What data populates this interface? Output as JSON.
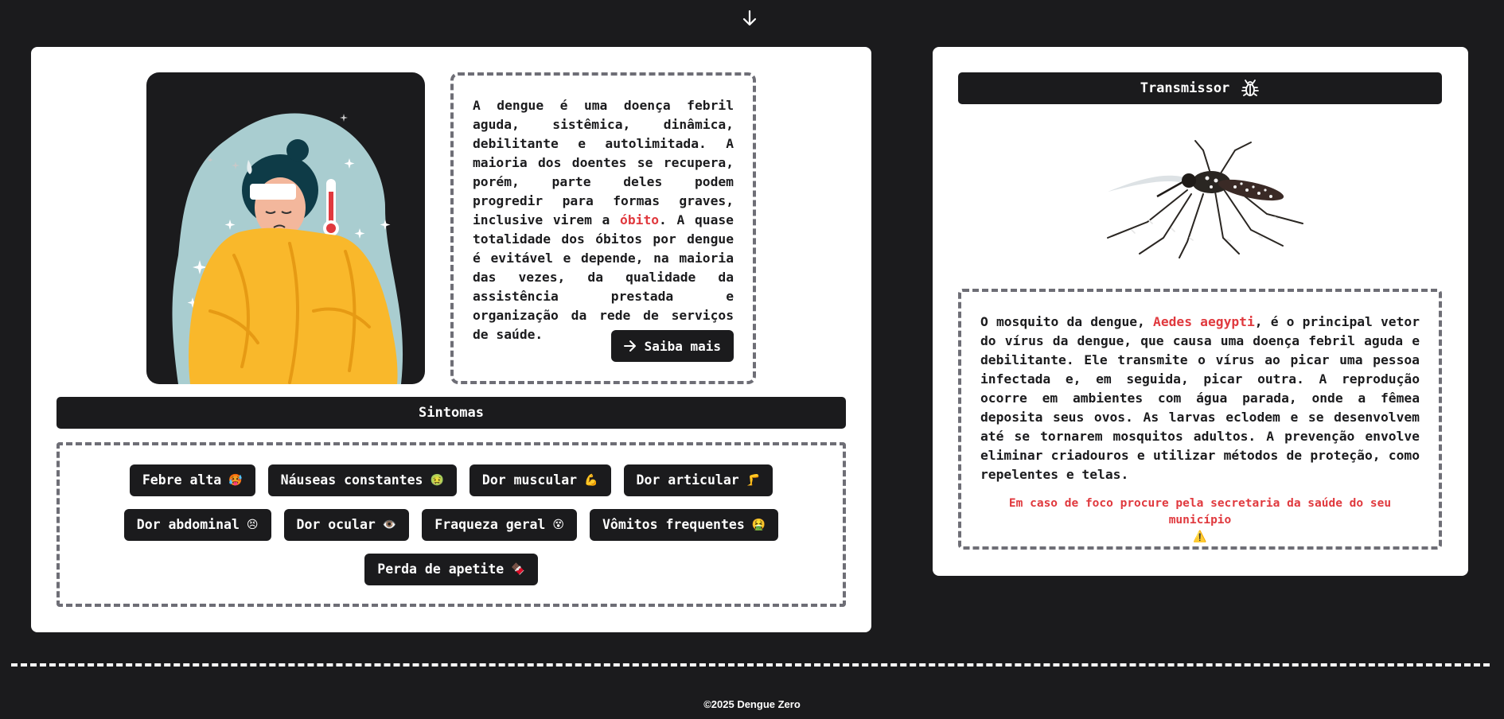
{
  "colors": {
    "background": "#1b1b1d",
    "accent_red": "#e0393e",
    "dashed_border": "#6e6e76"
  },
  "nav": {
    "scroll_icon": "arrow-down-icon"
  },
  "intro": {
    "text_before": "A dengue é uma doença febril aguda, sistêmica, dinâmica, debilitante e autolimitada. A maioria dos doentes se recupera, porém, parte deles podem progredir para formas graves, inclusive virem a ",
    "highlight": "óbito",
    "text_after": ". A quase totalidade dos óbitos por dengue é evitável e depende, na maioria das vezes, da qualidade da assistência prestada e organização da rede de serviços de saúde.",
    "button_label": "Saiba mais",
    "button_icon": "arrow-right-icon"
  },
  "symptoms": {
    "title": "Sintomas",
    "rows": [
      [
        {
          "label": "Febre alta",
          "emoji": "🥵"
        },
        {
          "label": "Náuseas constantes",
          "emoji": "🤢"
        },
        {
          "label": "Dor muscular",
          "emoji": "💪"
        },
        {
          "label": "Dor articular",
          "emoji": "🦵"
        }
      ],
      [
        {
          "label": "Dor abdominal",
          "emoji": "😣"
        },
        {
          "label": "Dor ocular",
          "emoji": "👁️"
        },
        {
          "label": "Fraqueza geral",
          "emoji": "😵"
        },
        {
          "label": "Vômitos frequentes",
          "emoji": "🤮"
        }
      ],
      [
        {
          "label": "Perda de apetite",
          "emoji": "🍫"
        }
      ]
    ]
  },
  "transmissor": {
    "title": "Transmissor",
    "title_icon": "bug-icon",
    "text_before": "O mosquito da dengue, ",
    "highlight": "Aedes aegypti",
    "text_after": ", é o principal vetor do vírus da dengue, que causa uma doença febril aguda e debilitante. Ele transmite o vírus ao picar uma pessoa infectada e, em seguida, picar outra. A reprodução ocorre em ambientes com água parada, onde a fêmea deposita seus ovos. As larvas eclodem e se desenvolvem até se tornarem mosquitos adultos. A prevenção envolve eliminar criadouros e utilizar métodos de proteção, como repelentes e telas.",
    "warning": "Em caso de foco procure pela secretaria da saúde do seu município",
    "warning_emoji": "⚠️"
  },
  "footer": {
    "text": "©2025 Dengue Zero"
  }
}
